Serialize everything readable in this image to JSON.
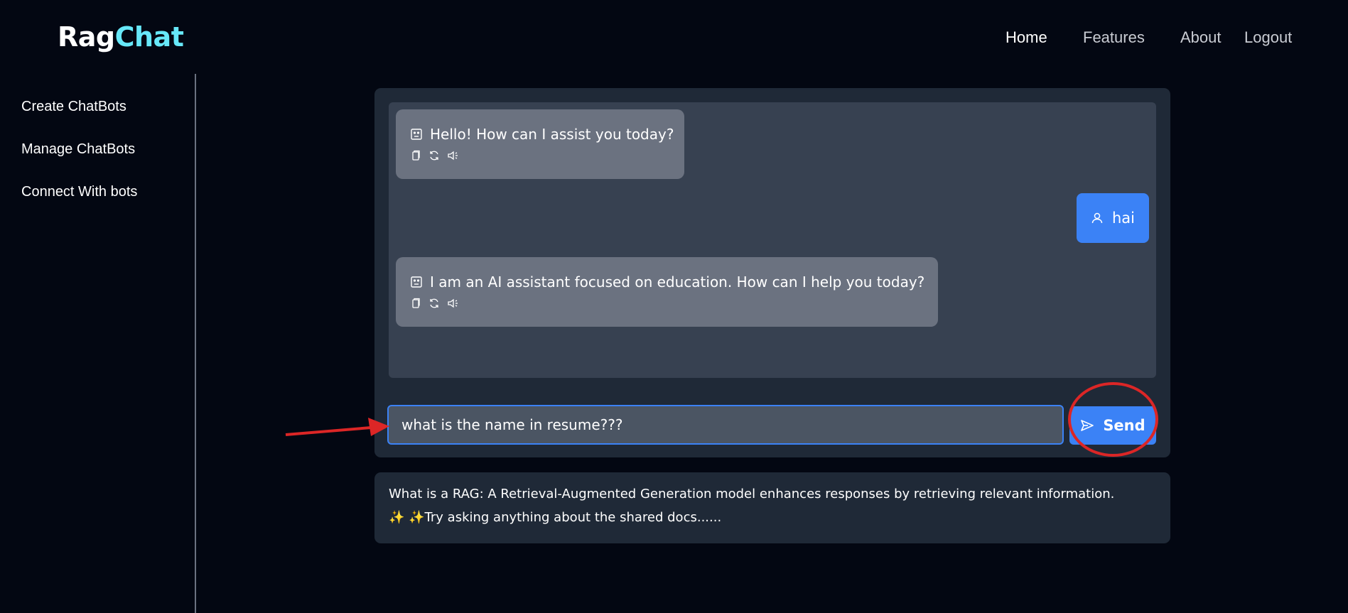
{
  "header": {
    "logo_part1": "Rag",
    "logo_part2": "Chat",
    "nav": [
      {
        "label": "Home"
      },
      {
        "label": "Features"
      },
      {
        "label": "About"
      },
      {
        "label": "Logout"
      }
    ]
  },
  "sidebar": {
    "items": [
      {
        "label": "Create ChatBots"
      },
      {
        "label": "Manage ChatBots"
      },
      {
        "label": "Connect With bots"
      }
    ]
  },
  "chat": {
    "messages": [
      {
        "role": "bot",
        "text": "Hello! How can I assist you today?",
        "icon": "bot-icon",
        "actions": [
          "copy-icon",
          "regenerate-icon",
          "speaker-icon"
        ]
      },
      {
        "role": "user",
        "text": "hai",
        "icon": "user-icon"
      },
      {
        "role": "bot",
        "text": "I am an AI assistant focused on education. How can I help you today?",
        "icon": "bot-icon",
        "actions": [
          "copy-icon",
          "regenerate-icon",
          "speaker-icon"
        ]
      }
    ],
    "input_value": "what is the name in resume???",
    "send_label": "Send",
    "send_icon": "send-icon"
  },
  "info": {
    "line1": "What is a RAG: A Retrieval-Augmented Generation model enhances responses by retrieving relevant information.",
    "line2": "✨ ✨Try asking anything about the shared docs......"
  },
  "colors": {
    "background": "#030712",
    "panel": "#1f2937",
    "messages_area": "#374151",
    "bot_bubble": "#6b7280",
    "accent": "#3b82f6",
    "logo_accent": "#67e8f9",
    "annotation": "#dc2626"
  }
}
